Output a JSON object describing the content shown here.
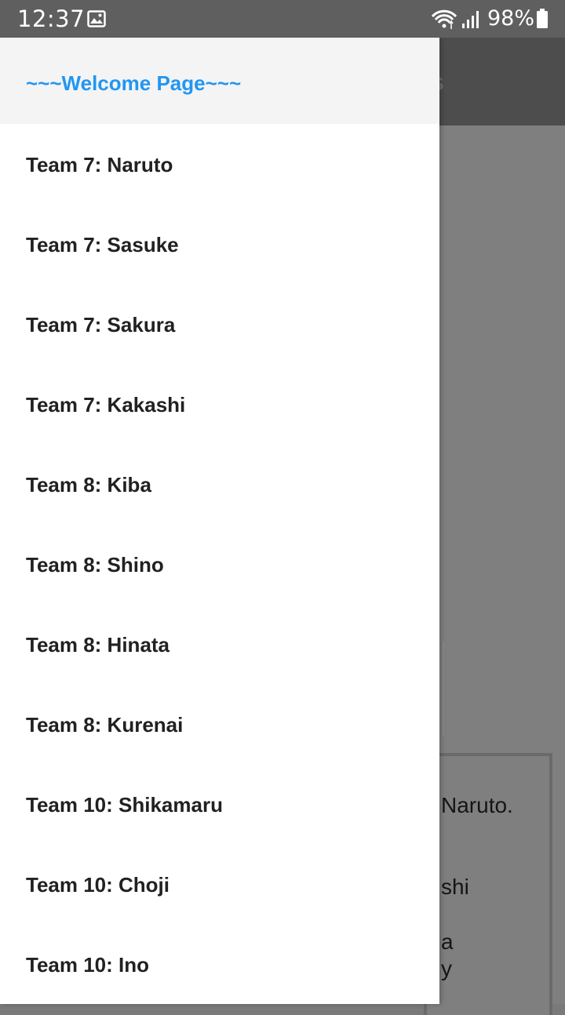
{
  "status_bar": {
    "time": "12:37",
    "battery": "98%",
    "icons": [
      "image-icon",
      "wifi-icon",
      "signal-icon",
      "battery-icon"
    ]
  },
  "background": {
    "toolbar_peek": "s",
    "text_lines": [
      "Naruto.",
      "shi",
      "a",
      "y"
    ]
  },
  "drawer": {
    "header_title": "~~~Welcome Page~~~",
    "header_color": "#2196f3",
    "items": [
      {
        "label": "Team 7: Naruto"
      },
      {
        "label": "Team 7: Sasuke"
      },
      {
        "label": "Team 7: Sakura"
      },
      {
        "label": "Team 7: Kakashi"
      },
      {
        "label": "Team 8: Kiba"
      },
      {
        "label": "Team 8: Shino"
      },
      {
        "label": "Team 8: Hinata"
      },
      {
        "label": "Team 8: Kurenai"
      },
      {
        "label": "Team 10: Shikamaru"
      },
      {
        "label": "Team 10: Choji"
      },
      {
        "label": "Team 10: Ino"
      }
    ]
  }
}
